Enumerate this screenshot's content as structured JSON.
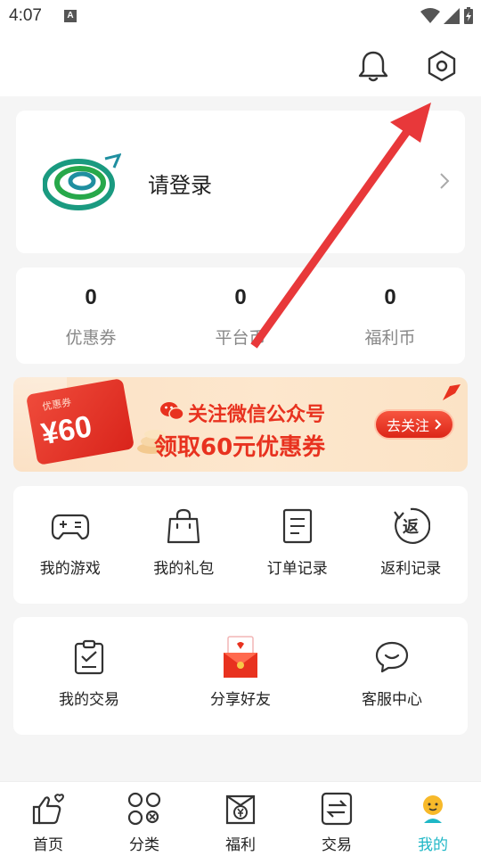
{
  "status_bar": {
    "time": "4:07",
    "notif_badge": "A"
  },
  "top_bar": {
    "icons": [
      "bell-icon",
      "settings-hexagon-icon"
    ]
  },
  "account": {
    "login_text": "请登录"
  },
  "stats": [
    {
      "value": "0",
      "label": "优惠券"
    },
    {
      "value": "0",
      "label": "平台币"
    },
    {
      "value": "0",
      "label": "福利币"
    }
  ],
  "banner": {
    "coupon_tag": "优惠券",
    "coupon_amount": "¥60",
    "line1": "关注微信公众号",
    "line2": "领取60元优惠券",
    "button": "去关注"
  },
  "menu_row1": [
    {
      "label": "我的游戏",
      "icon": "gamepad-icon"
    },
    {
      "label": "我的礼包",
      "icon": "gift-bag-icon"
    },
    {
      "label": "订单记录",
      "icon": "order-list-icon"
    },
    {
      "label": "返利记录",
      "icon": "rebate-icon"
    }
  ],
  "menu_row2": [
    {
      "label": "我的交易",
      "icon": "clipboard-check-icon"
    },
    {
      "label": "分享好友",
      "icon": "red-envelope-icon"
    },
    {
      "label": "客服中心",
      "icon": "chat-bubble-icon"
    }
  ],
  "rebate_glyph": "返",
  "tabs": [
    {
      "label": "首页",
      "icon": "thumbs-up-heart-icon"
    },
    {
      "label": "分类",
      "icon": "category-grid-icon"
    },
    {
      "label": "福利",
      "icon": "welfare-yen-icon"
    },
    {
      "label": "交易",
      "icon": "trade-swap-icon"
    },
    {
      "label": "我的",
      "icon": "profile-avatar-icon",
      "active": true
    }
  ],
  "colors": {
    "accent": "#1fb7c6",
    "banner_red": "#e8321f",
    "arrow_red": "#e8383a"
  }
}
